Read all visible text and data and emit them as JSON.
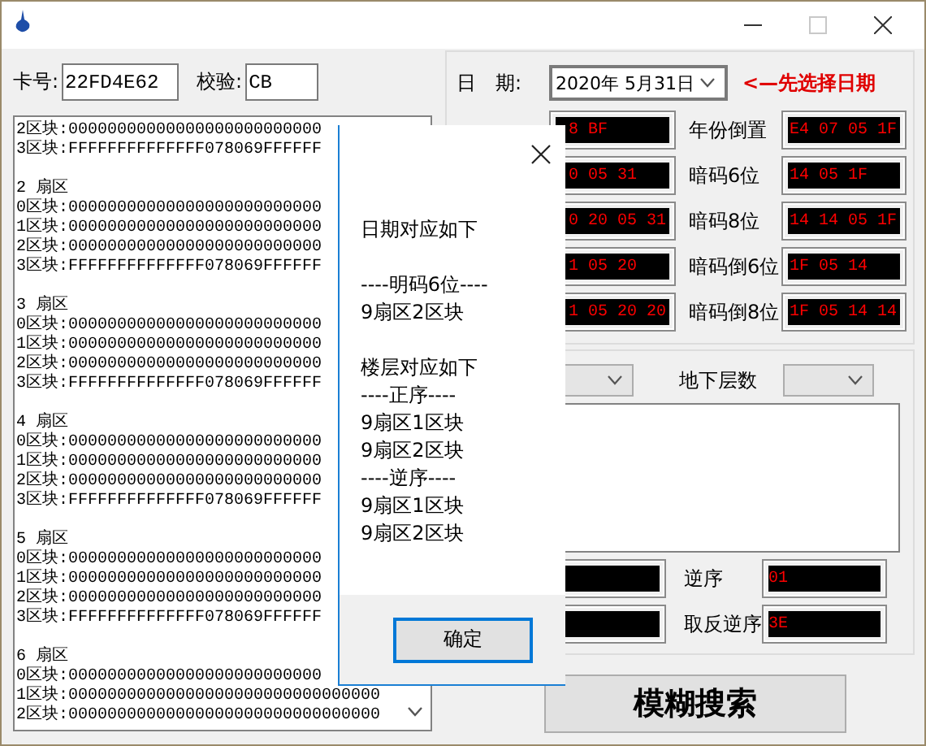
{
  "card": {
    "label": "卡号:",
    "value": "22FD4E62"
  },
  "check": {
    "label": "校验:",
    "value": "CB"
  },
  "dump": {
    "groups": [
      {
        "blocks": [
          "2区块:00000000000000000000000000",
          "3区块:FFFFFFFFFFFFFF078069FFFFFF"
        ]
      },
      {
        "header": "2 扇区",
        "blocks": [
          "0区块:00000000000000000000000000",
          "1区块:00000000000000000000000000",
          "2区块:00000000000000000000000000",
          "3区块:FFFFFFFFFFFFFF078069FFFFFF"
        ]
      },
      {
        "header": "3 扇区",
        "blocks": [
          "0区块:00000000000000000000000000",
          "1区块:00000000000000000000000000",
          "2区块:00000000000000000000000000",
          "3区块:FFFFFFFFFFFFFF078069FFFFFF"
        ]
      },
      {
        "header": "4 扇区",
        "blocks": [
          "0区块:00000000000000000000000000",
          "1区块:00000000000000000000000000",
          "2区块:00000000000000000000000000",
          "3区块:FFFFFFFFFFFFFF078069FFFFFF"
        ]
      },
      {
        "header": "5 扇区",
        "blocks": [
          "0区块:00000000000000000000000000",
          "1区块:00000000000000000000000000",
          "2区块:00000000000000000000000000",
          "3区块:FFFFFFFFFFFFFF078069FFFFFF"
        ]
      },
      {
        "header": "6 扇区",
        "blocks": [
          "0区块:00000000000000000000000000",
          "1区块:00000000000000000000000000000000",
          "2区块:00000000000000000000000000000000"
        ]
      }
    ]
  },
  "date": {
    "label": "日　期:",
    "value": "2020年  5月31日",
    "hint": "<—先选择日期"
  },
  "codes": [
    {
      "left_value": "8 BF",
      "right_label": "年份倒置",
      "right_value": "E4 07 05 1F"
    },
    {
      "left_value": "0 05 31",
      "right_label": "暗码6位",
      "right_value": "14 05 1F"
    },
    {
      "left_value": "0 20 05 31",
      "right_label": "暗码8位",
      "right_value": "14 14 05 1F"
    },
    {
      "left_value": "1 05 20",
      "right_label": "暗码倒6位",
      "right_value": "1F 05 14"
    },
    {
      "left_value": "1 05 20 20",
      "right_label": "暗码倒8位",
      "right_value": "1F 05 14 14"
    }
  ],
  "floor": {
    "label": "地下层数"
  },
  "orders": [
    {
      "label": "逆序",
      "value": "01"
    },
    {
      "label": "取反逆序",
      "value": "3E"
    }
  ],
  "search_button": "模糊搜索",
  "dialog": {
    "paragraphs": [
      [
        "日期对应如下"
      ],
      [
        "----明码6位----",
        "9扇区2区块"
      ],
      [
        "楼层对应如下",
        "----正序----",
        "9扇区1区块",
        "9扇区2区块",
        "----逆序----",
        "9扇区1区块",
        "9扇区2区块"
      ]
    ],
    "ok": "确定"
  }
}
